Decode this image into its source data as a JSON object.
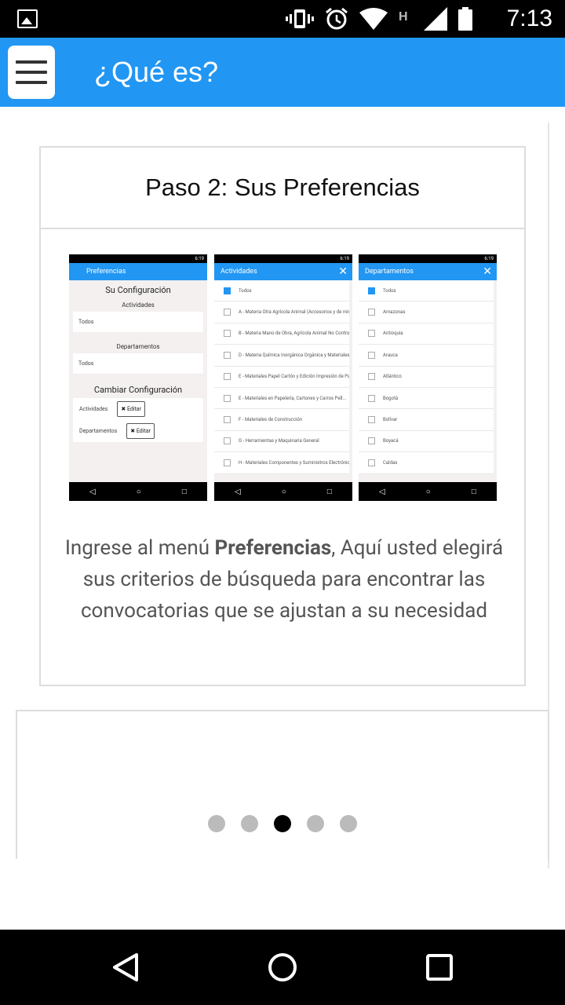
{
  "status_bar": {
    "time": "7:13",
    "icons": [
      "image-icon",
      "vibrate-icon",
      "alarm-icon",
      "wifi-icon",
      "h-network-icon",
      "signal-icon",
      "battery-icon"
    ]
  },
  "app_bar": {
    "title": "¿Qué es?"
  },
  "card": {
    "title": "Paso 2: Sus Preferencias",
    "caption_before": "Ingrese al menú ",
    "caption_bold": "Preferencias",
    "caption_after": ", Aquí usted elegirá sus criterios de búsqueda para encontrar las convocatorias que se ajustan a su necesidad"
  },
  "screenshots": {
    "status_time": "6:19",
    "preferencias": {
      "title": "Preferencias",
      "heading": "Su Configuración",
      "actividades_label": "Actividades",
      "actividades_value": "Todos",
      "departamentos_label": "Departamentos",
      "departamentos_value": "Todos",
      "cambiar": "Cambiar Configuración",
      "row1_label": "Actividades",
      "row2_label": "Departamentos",
      "edit_label": "✖ Editar"
    },
    "actividades": {
      "title": "Actividades",
      "items": [
        "Todos",
        "A - Materia Otra Agrícola Animal (Accesorios y de minim...",
        "B - Materia Mano de Obra, Agrícola Animal No Controla...",
        "D - Materia Química Inorgánica Orgánica y Materiales ...",
        "E - Materiales Papel Cartón y Edición Impresión de Pa...",
        "E - Materiales en Papelería, Cartones y Carros Pell...",
        "F - Materiales de Construcción",
        "G - Herramientas y Maquinaria General",
        "H - Materiales Componentes y Suministros Electrónicos"
      ]
    },
    "departamentos": {
      "title": "Departamentos",
      "items": [
        "Todos",
        "Amazonas",
        "Antioquia",
        "Arauca",
        "Atlántico",
        "Bogotá",
        "Bolívar",
        "Boyacá",
        "Caldas"
      ]
    }
  },
  "pager": {
    "count": 5,
    "active_index": 2
  },
  "colors": {
    "primary": "#2196f3",
    "status_bar": "#000000",
    "dot_inactive": "#bbbbbb",
    "dot_active": "#000000"
  }
}
